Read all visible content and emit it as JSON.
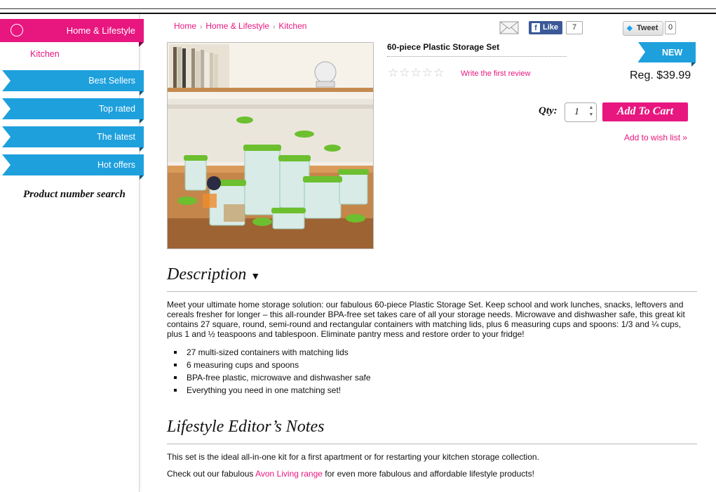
{
  "sidebar": {
    "category": "Home & Lifestyle",
    "subcategory": "Kitchen",
    "nav": [
      "Best Sellers",
      "Top rated",
      "The latest",
      "Hot offers"
    ],
    "search_label": "Product number search"
  },
  "breadcrumb": [
    "Home",
    "Home & Lifestyle",
    "Kitchen"
  ],
  "social": {
    "like_label": "Like",
    "like_count": "7",
    "tweet_label": "Tweet",
    "tweet_count": "0"
  },
  "product": {
    "title": "60-piece Plastic Storage Set",
    "rating": 0,
    "review_link": "Write the first review",
    "badge": "NEW",
    "price": "Reg. $39.99",
    "qty_label": "Qty:",
    "qty_value": "1",
    "add_to_cart": "Add To Cart",
    "wish_list": "Add to wish list »"
  },
  "description": {
    "heading": "Description",
    "text": "Meet your ultimate home storage solution: our fabulous 60-piece Plastic Storage Set. Keep school and work lunches, snacks, leftovers and cereals fresher for longer – this all-rounder BPA-free set takes care of all your storage needs. Microwave and dishwasher safe, this great kit contains 27 square, round, semi-round and rectangular containers with matching lids, plus 6 measuring cups and spoons: 1/3 and ¼ cups, plus 1 and ½ teaspoons and tablespoon. Eliminate pantry mess and restore order to your fridge!",
    "bullets": [
      "27 multi-sized containers with matching lids",
      "6 measuring cups and spoons",
      "BPA-free plastic, microwave and dishwasher safe",
      "Everything you need in one matching set!"
    ]
  },
  "notes": {
    "heading": "Lifestyle Editor’s Notes",
    "p1": "This set is the ideal all-in-one kit for a first apartment or for restarting your kitchen storage collection.",
    "p2_before": "Check out our fabulous ",
    "p2_link": "Avon Living range",
    "p2_after": " for even more fabulous and affordable lifestyle products!"
  },
  "colors": {
    "accent_pink": "#e8167f",
    "accent_blue": "#1ea0dd",
    "facebook": "#3b5998"
  }
}
